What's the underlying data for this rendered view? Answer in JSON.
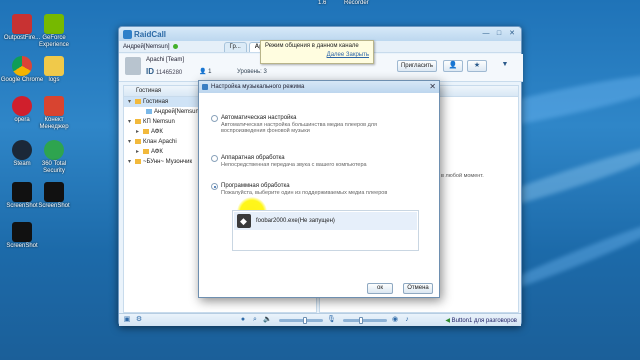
{
  "desktop": {
    "top_labels": [
      "1.6",
      "Recorder"
    ],
    "icons": [
      {
        "label": "OutpostFire...",
        "color": "#c83232"
      },
      {
        "label": "GeForce Experience",
        "color": "#76b900"
      },
      {
        "label": "Google Chrome",
        "color": "#e8b400"
      },
      {
        "label": "logs",
        "color": "#f0c94a"
      },
      {
        "label": "opera",
        "color": "#d01f2c"
      },
      {
        "label": "Конект Менеджер",
        "color": "#d84430"
      },
      {
        "label": "Steam",
        "color": "#1b2838"
      },
      {
        "label": "360 Total Security",
        "color": "#2ea44f"
      },
      {
        "label": "ScreenShot",
        "color": "#111111"
      },
      {
        "label": "ScreenShot",
        "color": "#111111"
      },
      {
        "label": "ScreenShot",
        "color": "#111111"
      }
    ]
  },
  "app": {
    "logo": "RaidCall",
    "window_controls": [
      "—",
      "□",
      "✕"
    ],
    "user": {
      "name": "Андрей[Nemsun]"
    },
    "tabs": [
      {
        "label": "Гр..."
      },
      {
        "label": "Apachi [Team]"
      }
    ],
    "channel": {
      "name": "Apachi [Team]",
      "id_label": "ID",
      "id_value": "11465280",
      "users": "1",
      "level_label": "Уровень: 3"
    },
    "invite_button": "Пригласить",
    "tooltip": {
      "text": "Режим общения в данном канале",
      "link": "Далее Закрыть"
    },
    "tree": {
      "header": "Гостиная",
      "rows": [
        {
          "label": "Гостиная",
          "selected": true,
          "indent": 0
        },
        {
          "label": "Андрей[Nemsun]",
          "selected": false,
          "indent": 2
        },
        {
          "label": "КП Nemsun",
          "selected": false,
          "indent": 0
        },
        {
          "label": "АФК",
          "selected": false,
          "indent": 1
        },
        {
          "label": "Клан Apachi",
          "selected": false,
          "indent": 0
        },
        {
          "label": "АФК",
          "selected": false,
          "indent": 1
        },
        {
          "label": "~БУнн~ Музончик",
          "selected": false,
          "indent": 0
        }
      ]
    },
    "right_note": "в любой момент.",
    "bottom": {
      "ptt_label": "Button1 для разговоров",
      "volume_level": 0.6,
      "mic_level": 0.4
    }
  },
  "dialog": {
    "title": "Настройка музыкального режима",
    "close": "✕",
    "options": [
      {
        "label": "Автоматическая настройка",
        "desc": "Автоматическая настройка большинства медиа плееров для воспроизведения фоновой музыки",
        "selected": false
      },
      {
        "label": "Аппаратная обработка",
        "desc": "Непосредственная передача звука с вашего компьютера",
        "selected": false
      },
      {
        "label": "Программная обработка",
        "desc": "Пожалуйста, выберите один из поддерживаемых медиа плееров",
        "selected": true
      }
    ],
    "player": "foobar2000.exe(Не запущен)",
    "ok": "ок",
    "cancel": "Отмена"
  }
}
